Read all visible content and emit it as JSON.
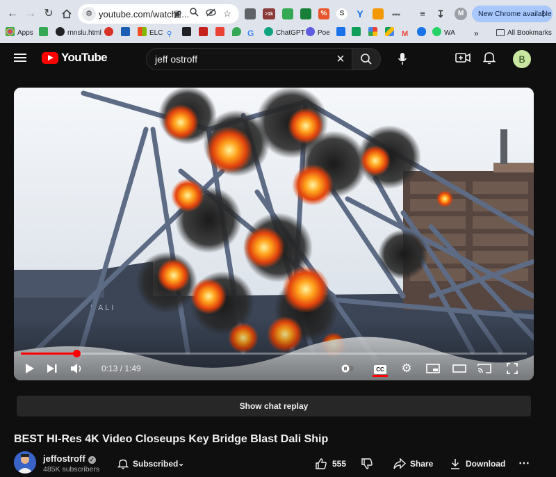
{
  "browser": {
    "url": "youtube.com/watch?...",
    "new_chrome_label": "New Chrome available",
    "bookmarks": [
      {
        "label": "Apps"
      },
      {
        "label": "rnnslu.html"
      },
      {
        "label": "ELC"
      },
      {
        "label": "ChatGPT"
      },
      {
        "label": "Poe"
      },
      {
        "label": "WA"
      }
    ],
    "all_bookmarks_label": "All Bookmarks",
    "extension_badge": ">1k",
    "profile_letter": "M"
  },
  "youtube": {
    "logo_text": "YouTube",
    "search_value": "jeff ostroff",
    "avatar_letter": "B",
    "player": {
      "time_text": "0:13 / 1:49",
      "progress": 0.11
    },
    "chat_replay_label": "Show chat replay",
    "video_title": "BEST HI-Res 4K Video Closeups Key Bridge Blast Dali Ship",
    "channel": {
      "name": "jeffostroff",
      "subscribers": "485K subscribers"
    },
    "subscribed_label": "Subscribed",
    "likes": "555",
    "share_label": "Share",
    "download_label": "Download"
  },
  "colors": {
    "brand_red": "#ff0000",
    "chrome_frame": "#dfe3eb",
    "yt_bg": "#0f0f0f",
    "new_chrome_pill": "#a8c7fa"
  }
}
